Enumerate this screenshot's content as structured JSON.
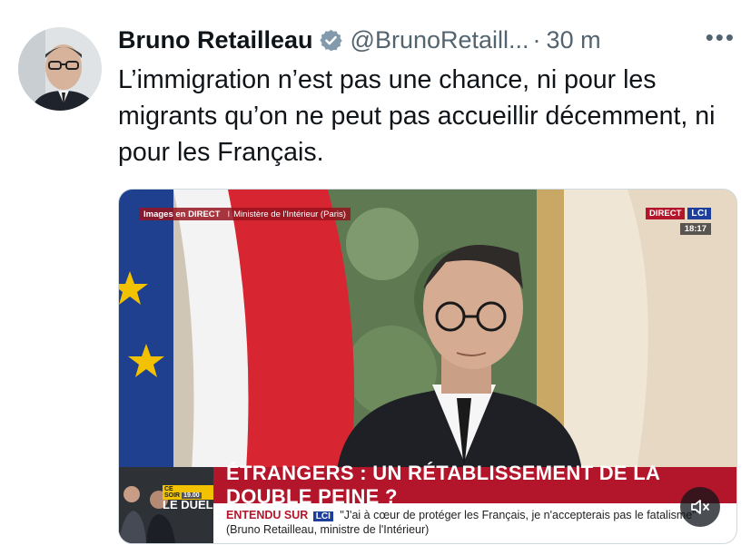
{
  "tweet": {
    "author_name": "Bruno Retailleau",
    "handle": "@BrunoRetaill...",
    "separator": "·",
    "time": "30 m",
    "more": "•••",
    "text": "L’immigration n’est pas une chance, ni pour les migrants qu’on ne peut pas accueillir décemment, ni pour les Français."
  },
  "video": {
    "overlay_live_prefix": "Images en DIRECT",
    "overlay_separator": "I",
    "overlay_location": "Ministère de l'Intérieur (Paris)",
    "direct_tag": "DIRECT",
    "channel": "LCI",
    "clock": "18:17",
    "preview_tag": "CE SOIR",
    "preview_time": "19.00",
    "preview_title": "LE DUEL",
    "headline": "ÉTRANGERS : UN RÉTABLISSEMENT DE LA DOUBLE PEINE ?",
    "quote_prefix": "ENTENDU SUR",
    "quote_channel": "LCI",
    "quote_text": "\"J'ai à cœur de protéger les Français, je n'accepterais pas le fatalisme\" (Bruno Retailleau, ministre de l'Intérieur)"
  },
  "colors": {
    "verified_badge": "#829aab",
    "muted_text": "#536471",
    "headline_red": "#b3162a",
    "lci_blue": "#1d3f9b"
  },
  "icons": {
    "verified": "verified-badge-icon",
    "more": "more-dots-icon",
    "mute": "volume-muted-icon"
  }
}
